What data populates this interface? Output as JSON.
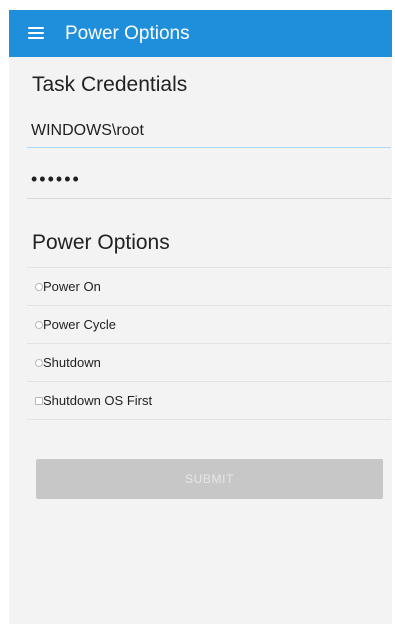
{
  "header": {
    "title": "Power Options",
    "menu_icon": "hamburger-menu-icon"
  },
  "credentials": {
    "title": "Task Credentials",
    "username_value": "WINDOWS\\root",
    "password_mask": "••••••"
  },
  "power_options": {
    "title": "Power Options",
    "items": [
      {
        "label": "Power On",
        "control": "radio",
        "checked": false
      },
      {
        "label": "Power Cycle",
        "control": "radio",
        "checked": false
      },
      {
        "label": "Shutdown",
        "control": "radio",
        "checked": false
      },
      {
        "label": "Shutdown OS First",
        "control": "checkbox",
        "checked": false
      }
    ]
  },
  "submit": {
    "label": "SUBMIT",
    "enabled": false
  },
  "colors": {
    "app_bar": "#1f8fdc",
    "surface": "#f3f3f3",
    "disabled_button": "#c7c7c7"
  }
}
